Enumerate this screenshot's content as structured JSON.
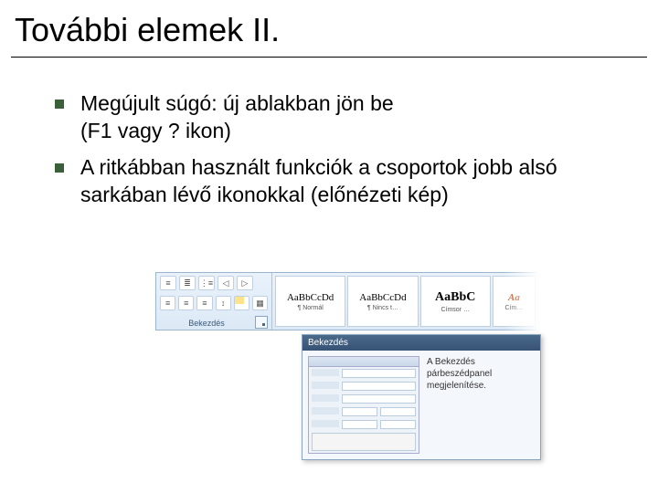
{
  "title": "További elemek II.",
  "bullets": [
    {
      "line1": "Megújult súgó: új ablakban jön be",
      "line2": "(F1 vagy ? ikon)"
    },
    {
      "line1": "A ritkábban használt funkciók a csoportok jobb alsó sarkában lévő ikonokkal (előnézeti kép)"
    }
  ],
  "ribbon": {
    "group_label": "Bekezdés",
    "styles": [
      {
        "sample": "AaBbCcDd",
        "caption": "¶ Normál",
        "class": "sample"
      },
      {
        "sample": "AaBbCcDd",
        "caption": "¶ Nincs t…",
        "class": "sample"
      },
      {
        "sample": "AaBbC",
        "caption": "Címsor …",
        "class": "sample big"
      },
      {
        "sample": "Aa",
        "caption": "Cím…",
        "class": "sample accent"
      }
    ]
  },
  "popup": {
    "title": "Bekezdés",
    "text": "A Bekezdés párbeszédpanel megjelenítése."
  }
}
